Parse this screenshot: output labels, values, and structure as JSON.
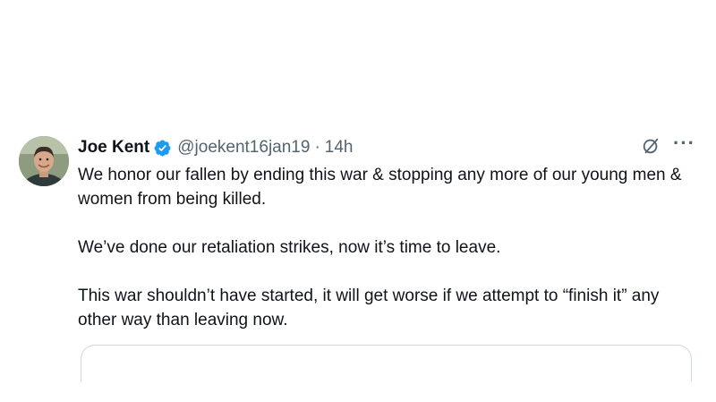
{
  "post": {
    "author": {
      "display_name": "Joe Kent",
      "handle": "@joekent16jan19",
      "verified": true,
      "avatar_icon": "avatar-photo"
    },
    "separator": "·",
    "timestamp": "14h",
    "paragraphs": [
      "We honor our fallen by ending this war & stopping any more of our young men & women from being killed.",
      "We’ve done our retaliation strikes, now it’s time to leave.",
      "This war shouldn’t have started, it will get worse if we attempt to “finish it” any other way than leaving now."
    ],
    "actions": {
      "grok_icon": "grok-icon",
      "more_label": "···"
    }
  },
  "colors": {
    "verified_blue": "#1d9bf0",
    "text_primary": "#0f1419",
    "text_secondary": "#536471",
    "border": "#cfd9de"
  }
}
